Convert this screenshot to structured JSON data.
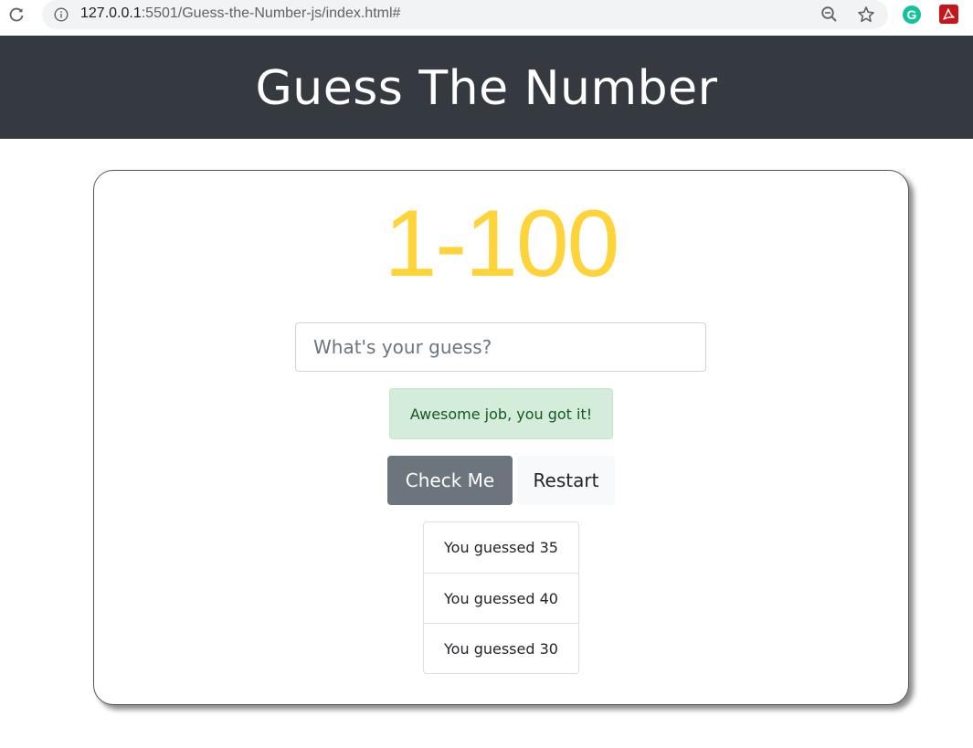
{
  "browser": {
    "url_host": "127.0.0.1",
    "url_rest": ":5501/Guess-the-Number-js/index.html#"
  },
  "header": {
    "title": "Guess The Number"
  },
  "game": {
    "range": "1-100",
    "input": {
      "placeholder": "What's your guess?",
      "value": ""
    },
    "message": "Awesome job, you got it!",
    "check_label": "Check Me",
    "restart_label": "Restart",
    "guesses": [
      "You guessed 35",
      "You guessed 40",
      "You guessed 30"
    ]
  },
  "colors": {
    "header_bg": "#343a40",
    "range_color": "#ffd43b",
    "alert_bg": "#d4edda",
    "alert_text": "#155724",
    "check_bg": "#6c757d"
  }
}
